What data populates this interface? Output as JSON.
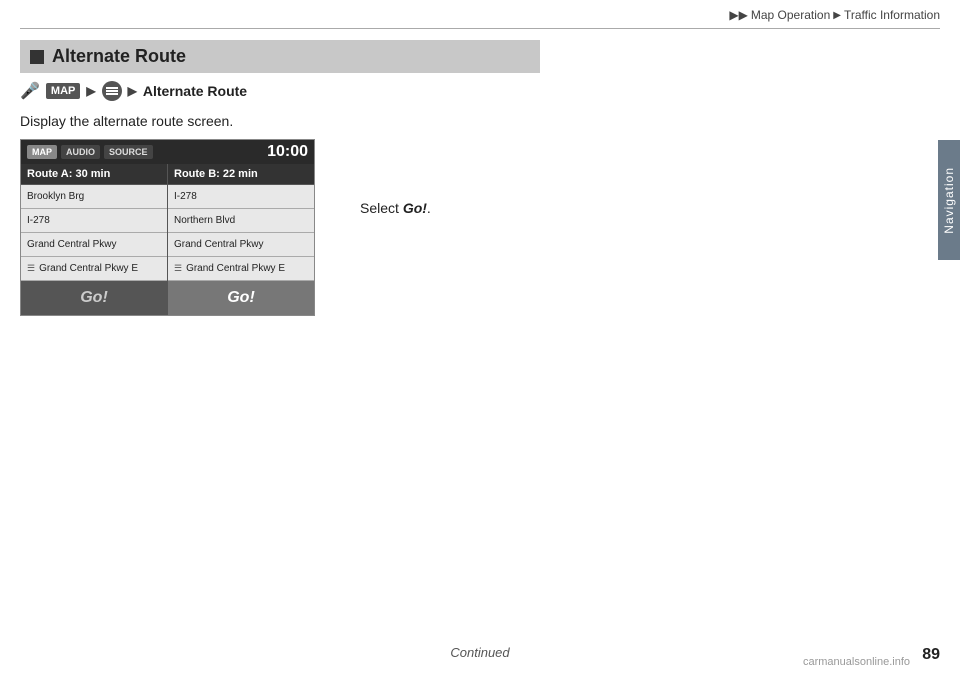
{
  "breadcrumb": {
    "arrow1": "▶▶",
    "part1": "Map Operation",
    "arrow2": "▶",
    "part2": "Traffic Information"
  },
  "section": {
    "heading": "Alternate Route"
  },
  "instruction": {
    "mic_label": "🎤",
    "map_badge": "MAP",
    "arrow": "▶",
    "menu_label": "☰",
    "arrow2": "▶",
    "route_label": "Alternate Route"
  },
  "body_text": "Display the alternate route screen.",
  "select_text": "Select ",
  "select_go": "Go!",
  "select_period": ".",
  "screen": {
    "tabs": [
      "MAP",
      "AUDIO",
      "SOURCE"
    ],
    "time": "10:00",
    "route_a_header": "Route A: 30 min",
    "route_b_header": "Route B: 22 min",
    "route_a_items": [
      {
        "text": "Brooklyn Brg",
        "icon": ""
      },
      {
        "text": "I-278",
        "icon": ""
      },
      {
        "text": "Grand Central Pkwy",
        "icon": ""
      },
      {
        "text": "Grand Central Pkwy E",
        "icon": "☰"
      }
    ],
    "route_b_items": [
      {
        "text": "I-278",
        "icon": ""
      },
      {
        "text": "Northern Blvd",
        "icon": ""
      },
      {
        "text": "Grand Central Pkwy",
        "icon": ""
      },
      {
        "text": "Grand Central Pkwy E",
        "icon": "☰"
      }
    ],
    "go_a_label": "Go!",
    "go_b_label": "Go!"
  },
  "footer": {
    "continued": "Continued",
    "page_number": "89",
    "watermark": "carmanualsonline.info"
  }
}
